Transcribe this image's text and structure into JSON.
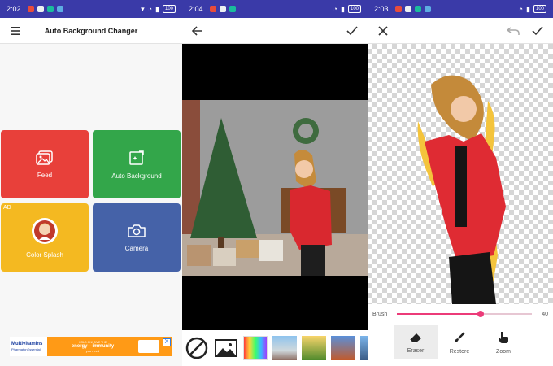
{
  "screens": [
    {
      "status": {
        "time": "2:02",
        "battery": "100"
      },
      "toolbar": {
        "title": "Auto Background Changer",
        "menu_icon": "hamburger-icon"
      },
      "tiles": [
        {
          "label": "Feed",
          "icon": "image-gallery-icon",
          "color": "#e8403a"
        },
        {
          "label": "Auto Background",
          "icon": "magic-edit-icon",
          "color": "#33a64a"
        },
        {
          "label": "Color Splash",
          "icon": "avatar-icon",
          "color": "#f4b921",
          "badge": "AD"
        },
        {
          "label": "Camera",
          "icon": "camera-icon",
          "color": "#4562a8"
        }
      ],
      "ad": {
        "brand": "Multivitamins",
        "brand_sub": "PharmatonEssential",
        "tagline_top": "HOLD ON! GIVE THE",
        "tagline_main": "energy—immunity",
        "tagline_cta": "you need",
        "close": "X"
      }
    },
    {
      "status": {
        "time": "2:04",
        "battery": "100"
      },
      "toolbar": {
        "back_icon": "arrow-left-icon",
        "confirm_icon": "check-icon"
      },
      "backgrounds": [
        "none-icon",
        "gallery-icon",
        "color-palette",
        "bg-tower",
        "bg-forest",
        "bg-bridge",
        "bg-city",
        "bg-lake"
      ]
    },
    {
      "status": {
        "time": "2:03",
        "battery": "100"
      },
      "toolbar": {
        "close_icon": "close-icon",
        "undo_icon": "undo-icon",
        "confirm_icon": "check-icon"
      },
      "brush": {
        "label": "Brush",
        "value": "40",
        "level": 0.62
      },
      "tools": [
        {
          "label": "Eraser",
          "icon": "eraser-icon",
          "active": true
        },
        {
          "label": "Restore",
          "icon": "brush-icon",
          "active": false
        },
        {
          "label": "Zoom",
          "icon": "hand-pointer-icon",
          "active": false
        }
      ]
    }
  ],
  "colors": {
    "statusbar": "#3a3aa8",
    "accent_pink": "#ec3b79"
  }
}
